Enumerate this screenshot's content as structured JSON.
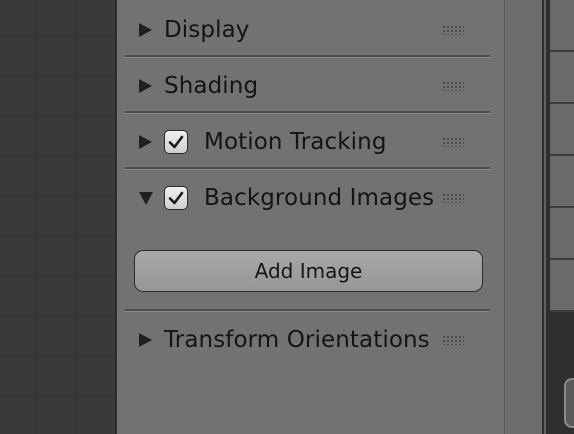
{
  "panel": {
    "sections": [
      {
        "label": "Display",
        "expanded": false,
        "has_checkbox": false
      },
      {
        "label": "Shading",
        "expanded": false,
        "has_checkbox": false
      },
      {
        "label": "Motion Tracking",
        "expanded": false,
        "has_checkbox": true,
        "checked": true
      },
      {
        "label": "Background Images",
        "expanded": true,
        "has_checkbox": true,
        "checked": true
      },
      {
        "label": "Transform Orientations",
        "expanded": false,
        "has_checkbox": false
      }
    ],
    "add_image_label": "Add Image"
  },
  "icons": {
    "collapsed": "triangle-right-icon",
    "expanded": "triangle-down-icon",
    "drag": "drag-grip-icon",
    "check": "checkbox-check-icon"
  },
  "colors": {
    "panel_bg": "#727272",
    "viewport_bg": "#393939",
    "text": "#141414"
  }
}
